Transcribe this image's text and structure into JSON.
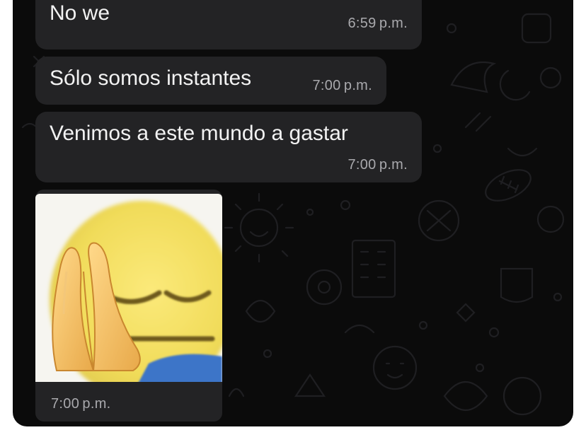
{
  "messages": [
    {
      "text": "No we",
      "time": "6:59 p.m."
    },
    {
      "text": "Sólo somos instantes",
      "time": "7:00 p.m."
    },
    {
      "text": "Venimos a este mundo a gastar",
      "time": "7:00 p.m."
    }
  ],
  "image_message": {
    "image": "praying-emoji-meme",
    "icon": "praying-hands-icon",
    "time": "7:00 p.m."
  },
  "colors": {
    "chat_background": "#0b0b0b",
    "bubble": "#232325",
    "text": "#f2f2f2",
    "timestamp": "#a9a9ad",
    "emoji_face": "#f1dc5a"
  }
}
